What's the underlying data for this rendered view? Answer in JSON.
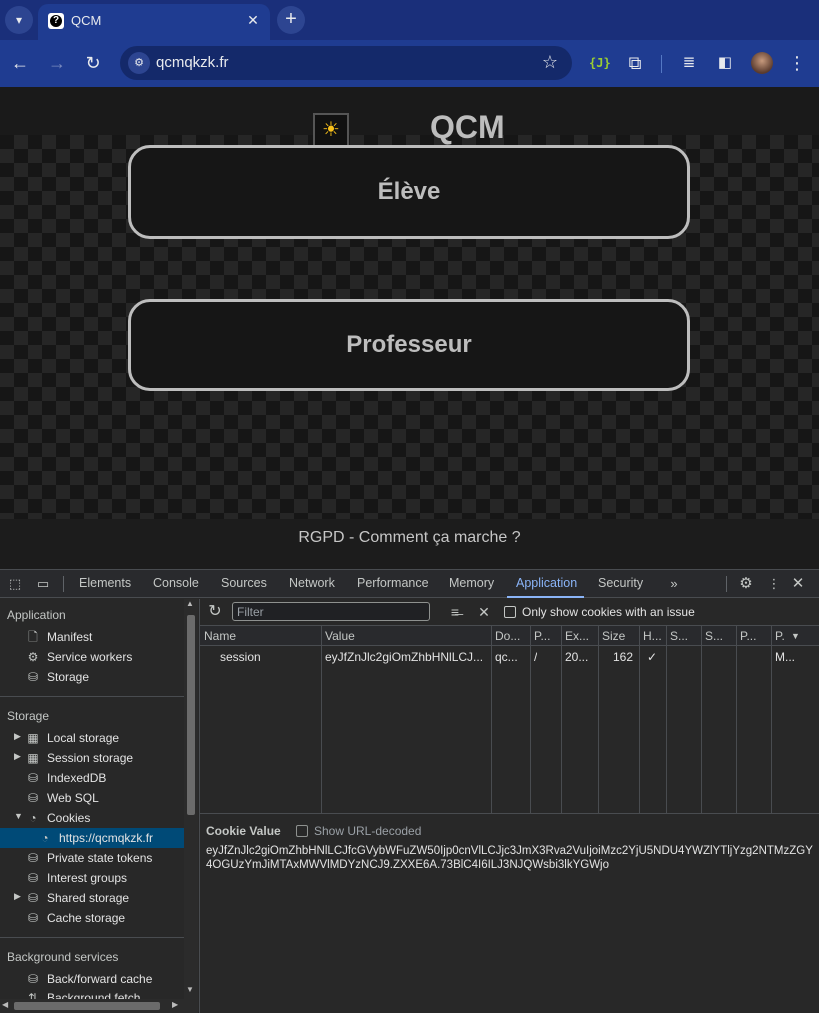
{
  "browser": {
    "tab_title": "QCM",
    "tab_close": "✕",
    "new_tab": "+",
    "url": "qcmqkzk.fr",
    "extension_json": "{J}"
  },
  "page": {
    "title": "QCM",
    "theme_icon": "☀",
    "btn_eleve": "Élève",
    "btn_prof": "Professeur",
    "footer_link": "RGPD - Comment ça marche ?"
  },
  "devtools": {
    "tabs": [
      "Elements",
      "Console",
      "Sources",
      "Network",
      "Performance",
      "Memory",
      "Application",
      "Security"
    ],
    "active_tab": "Application",
    "sidebar": {
      "application_header": "Application",
      "application_items": [
        "Manifest",
        "Service workers",
        "Storage"
      ],
      "storage_header": "Storage",
      "storage_items": [
        "Local storage",
        "Session storage",
        "IndexedDB",
        "Web SQL",
        "Cookies",
        "https://qcmqkzk.fr",
        "Private state tokens",
        "Interest groups",
        "Shared storage",
        "Cache storage"
      ],
      "background_header": "Background services",
      "background_items": [
        "Back/forward cache",
        "Background fetch"
      ]
    },
    "filter": {
      "placeholder": "Filter",
      "only_issues_label": "Only show cookies with an issue"
    },
    "table": {
      "headers": [
        "Name",
        "Value",
        "Do...",
        "P...",
        "Ex...",
        "Size",
        "H...",
        "S...",
        "S...",
        "P...",
        "P."
      ],
      "sort_indicator": "▼",
      "rows": [
        {
          "name": "session",
          "value": "eyJfZnJlc2giOmZhbHNlLCJ...",
          "domain": "qc...",
          "path": "/",
          "expires": "20...",
          "size": "162",
          "httponly": "✓",
          "secure": "",
          "samesite": "",
          "partition": "",
          "priority": "M..."
        }
      ]
    },
    "cookie_value": {
      "title": "Cookie Value",
      "decode_label": "Show URL-decoded",
      "value": "eyJfZnJlc2giOmZhbHNlLCJfcGVybWFuZW50Ijp0cnVlLCJjc3JmX3Rva2VuIjoiMzc2YjU5NDU4YWZlYTljYzg2NTMzZGY4OGUzYmJiMTAxMWVlMDYzNCJ9.ZXXE6A.73BlC4I6ILJ3NJQWsbi3lkYGWjo"
    }
  }
}
